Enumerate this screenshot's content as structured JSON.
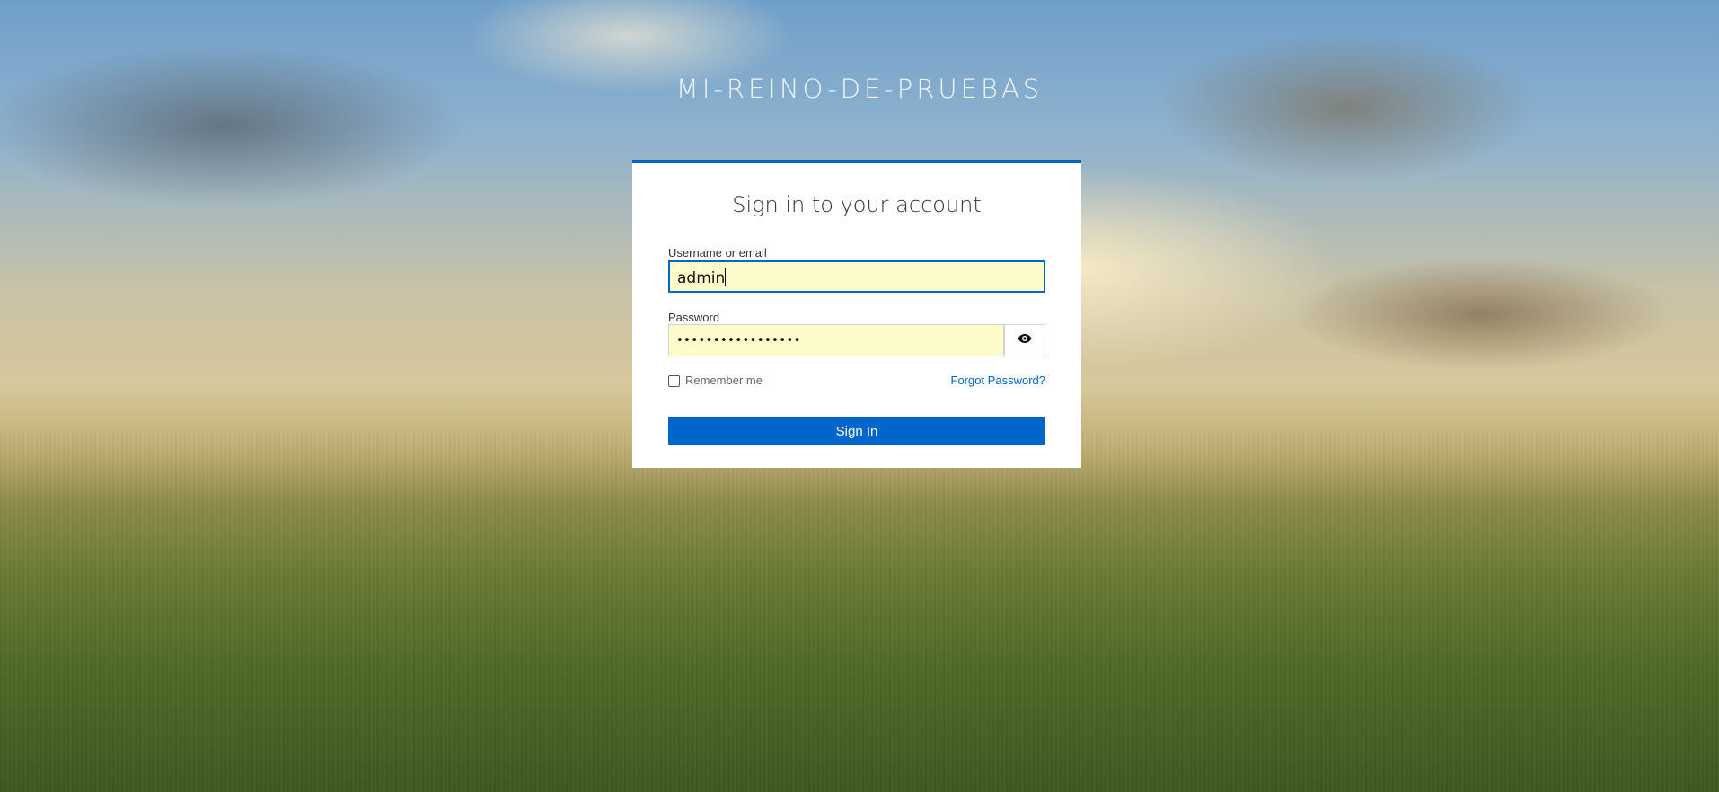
{
  "realm_name": "MI-REINO-DE-PRUEBAS",
  "login": {
    "title": "Sign in to your account",
    "username_label": "Username or email",
    "username_value": "admin",
    "password_label": "Password",
    "password_masked": "•••••••••••••••••",
    "show_password_icon": "eye-icon",
    "remember_label": "Remember me",
    "remember_checked": false,
    "forgot_link": "Forgot Password?",
    "submit_label": "Sign In"
  },
  "colors": {
    "accent": "#0066cc",
    "autofill_bg": "#fdfbc9"
  }
}
